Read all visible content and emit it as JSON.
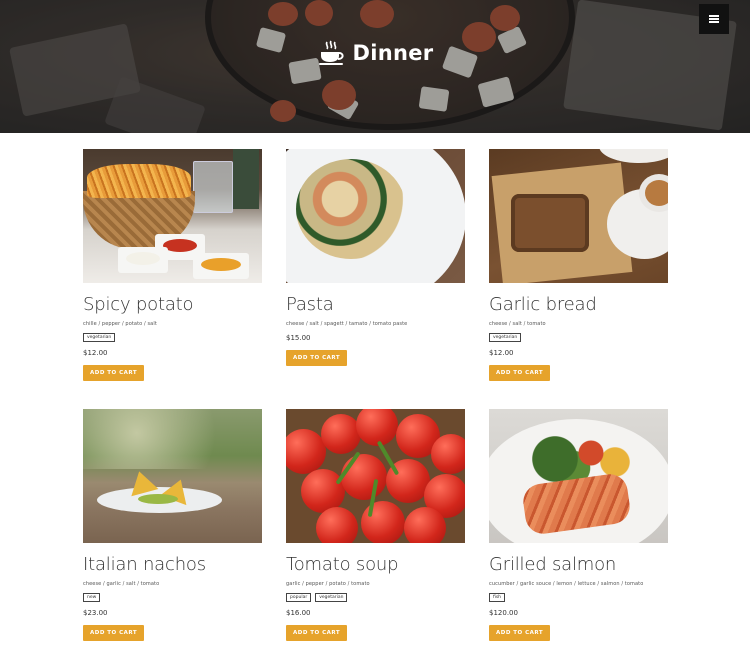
{
  "header": {
    "title": "Dinner",
    "logo_icon": "steaming-cup-icon",
    "menu_icon": "hamburger-icon"
  },
  "colors": {
    "accent": "#e6a32b",
    "text": "#333333",
    "menu_button_bg": "#111111"
  },
  "products": [
    {
      "name": "Spicy potato",
      "ingredients": "chille / pepper / potato / salt",
      "tags": [
        "vegetarian"
      ],
      "price": "$12.00",
      "button": "ADD TO CART",
      "image": "fries-photo"
    },
    {
      "name": "Pasta",
      "ingredients": "cheese / salt / spagett / tamato / tomato paste",
      "tags": [],
      "price": "$15.00",
      "button": "ADD TO CART",
      "image": "pasta-photo"
    },
    {
      "name": "Garlic bread",
      "ingredients": "cheese / salt / tomato",
      "tags": [
        "vegetarian"
      ],
      "price": "$12.00",
      "button": "ADD TO CART",
      "image": "bread-photo"
    },
    {
      "name": "Italian nachos",
      "ingredients": "cheese / garlic / salt / tomato",
      "tags": [
        "new"
      ],
      "price": "$23.00",
      "button": "ADD TO CART",
      "image": "nachos-photo"
    },
    {
      "name": "Tomato soup",
      "ingredients": "garlic / pepper / potato / tomato",
      "tags": [
        "popular",
        "vegetarian"
      ],
      "price": "$16.00",
      "button": "ADD TO CART",
      "image": "tomatoes-photo"
    },
    {
      "name": "Grilled salmon",
      "ingredients": "cucumber / garlic souce / lemon / lettuce / salmon / tomato",
      "tags": [
        "fish"
      ],
      "price": "$120.00",
      "button": "ADD TO CART",
      "image": "salmon-photo"
    }
  ]
}
